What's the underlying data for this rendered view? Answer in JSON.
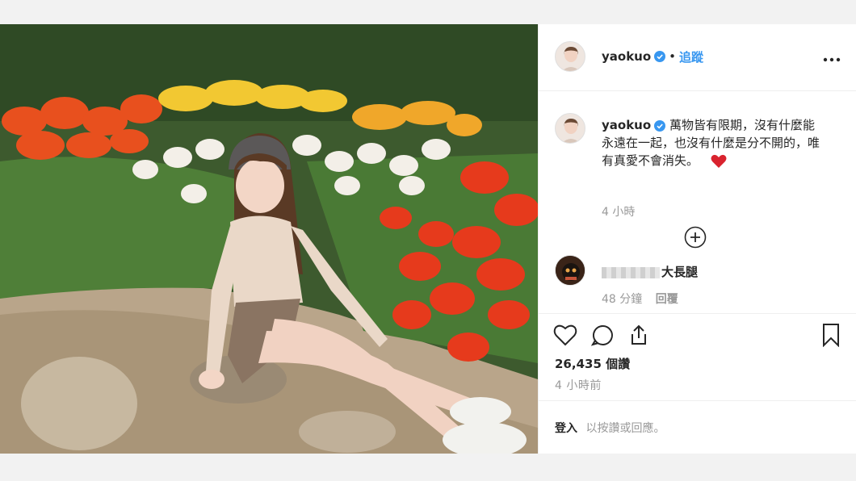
{
  "post": {
    "username": "yaokuo",
    "separator": "•",
    "follow_label": "追蹤",
    "more_icon": "more-horizontal-icon",
    "caption_text": "萬物皆有限期，沒有什麼能永遠在一起，也沒有什麼是分不開的，唯有真愛不會消失。",
    "caption_emoji": "heart-emoji",
    "caption_time": "4 小時",
    "load_more_icon": "plus-circle-icon",
    "likes": "26,435 個讚",
    "posted_time": "4 小時前",
    "login_link": "登入",
    "login_prompt": "以按讚或回應。"
  },
  "comment": {
    "username_visible": "大長腿",
    "time": "48 分鐘",
    "reply_label": "回覆"
  },
  "actions": {
    "like_icon": "heart-icon",
    "comment_icon": "comment-icon",
    "share_icon": "share-icon",
    "save_icon": "bookmark-icon"
  },
  "colors": {
    "accent": "#3897f0",
    "heart": "#ed4956",
    "text": "#262626",
    "muted": "#999999"
  }
}
